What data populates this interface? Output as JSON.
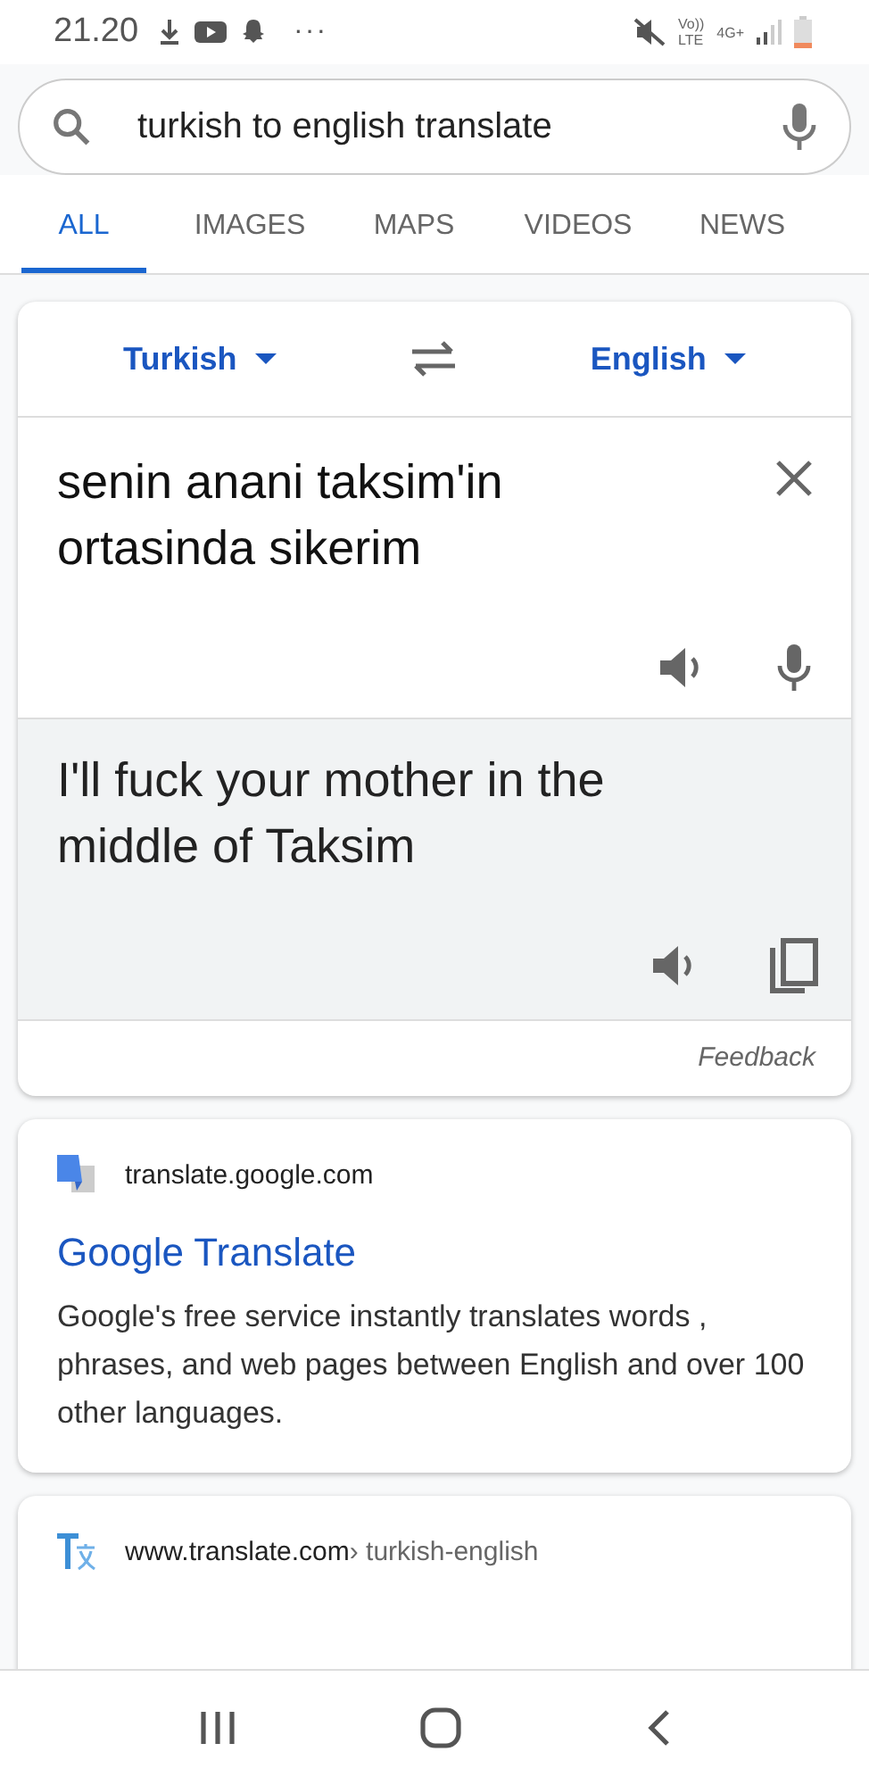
{
  "status_bar": {
    "time": "21.20",
    "more": "···",
    "volte": "Vo))",
    "lte": "LTE",
    "network": "4G+"
  },
  "search": {
    "value": "turkish to english translate"
  },
  "tabs": [
    {
      "label": "ALL",
      "selected": true
    },
    {
      "label": "IMAGES",
      "selected": false
    },
    {
      "label": "MAPS",
      "selected": false
    },
    {
      "label": "VIDEOS",
      "selected": false
    },
    {
      "label": "NEWS",
      "selected": false
    }
  ],
  "translator": {
    "source_language": "Turkish",
    "target_language": "English",
    "source_text": "senin anani taksim'in ortasinda sikerim",
    "translated_text": "I'll fuck your mother in the middle of Taksim",
    "feedback": "Feedback"
  },
  "results": [
    {
      "kind": "google",
      "site": "translate.google.com",
      "title": "Google Translate",
      "snippet": "Google's free service instantly translates words , phrases, and web pages between English and over 100 other languages."
    },
    {
      "kind": "translatecom",
      "site": "www.translate.com",
      "path": "› turkish-english"
    }
  ]
}
